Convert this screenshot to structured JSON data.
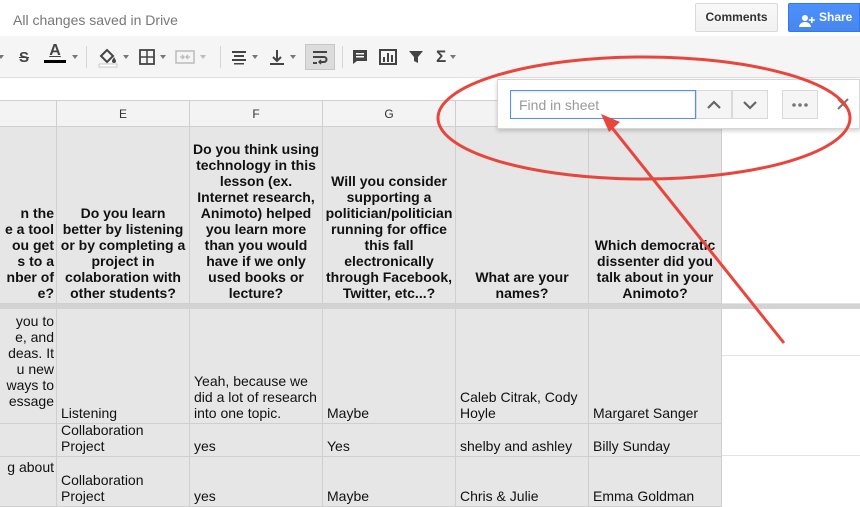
{
  "header": {
    "save_status": "All changes saved in Drive",
    "comments_label": "Comments",
    "share_label": "Share"
  },
  "toolbar": {
    "icons": [
      "strikethrough-icon",
      "text-color-icon",
      "fill-color-icon",
      "borders-icon",
      "merge-cells-icon",
      "horizontal-align-icon",
      "vertical-align-icon",
      "text-wrap-icon",
      "insert-comment-icon",
      "insert-chart-icon",
      "filter-icon",
      "functions-icon"
    ],
    "strike_glyph": "S",
    "text_color_glyph": "A",
    "functions_glyph": "Σ",
    "text_color": "#000000"
  },
  "find": {
    "placeholder": "Find in sheet",
    "value": ""
  },
  "grid": {
    "columns": [
      "E",
      "F",
      "G"
    ],
    "headers": {
      "d": "n the\ne a tool\nou get\ns to a\nnber of\ne?",
      "e": "Do you learn better by listening or by completing a project in colaboration with other students?",
      "f": "Do you think using technology in this lesson (ex. Internet research, Animoto) helped you learn more than you would have if we only used books or lecture?",
      "g": "Will you consider supporting a politician/politician running for office this fall electronically through Facebook, Twitter, etc...?",
      "h": "What are your names?",
      "i": "Which democratic dissenter did you talk about in your Animoto?"
    },
    "rows": [
      {
        "d": "you to\ne, and\ndeas. It\nu new\nways to\nessage",
        "e": "Listening",
        "f": "Yeah, because we did a lot of research into one topic.",
        "g": "Maybe",
        "h": "Caleb Citrak, Cody Hoyle",
        "i": "Margaret Sanger"
      },
      {
        "d": "",
        "e": "Collaboration Project",
        "f": "yes",
        "g": "Yes",
        "h": "shelby and ashley",
        "i": "Billy Sunday"
      },
      {
        "d": "g about",
        "e": "Collaboration Project",
        "f": "yes",
        "g": "Maybe",
        "h": "Chris & Julie",
        "i": "Emma Goldman"
      }
    ]
  },
  "colors": {
    "annotation": "#e8453c",
    "share_blue": "#4787ed",
    "cell_gray": "#e6e6e6",
    "find_focus": "#4d90fe"
  }
}
